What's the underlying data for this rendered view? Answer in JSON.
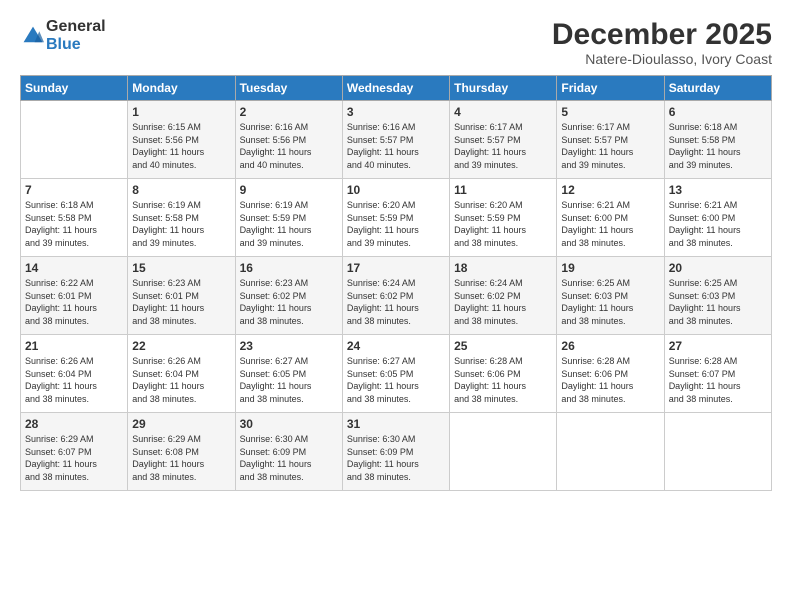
{
  "logo": {
    "general": "General",
    "blue": "Blue"
  },
  "title": "December 2025",
  "location": "Natere-Dioulasso, Ivory Coast",
  "days_of_week": [
    "Sunday",
    "Monday",
    "Tuesday",
    "Wednesday",
    "Thursday",
    "Friday",
    "Saturday"
  ],
  "weeks": [
    [
      {
        "day": "",
        "info": ""
      },
      {
        "day": "1",
        "info": "Sunrise: 6:15 AM\nSunset: 5:56 PM\nDaylight: 11 hours\nand 40 minutes."
      },
      {
        "day": "2",
        "info": "Sunrise: 6:16 AM\nSunset: 5:56 PM\nDaylight: 11 hours\nand 40 minutes."
      },
      {
        "day": "3",
        "info": "Sunrise: 6:16 AM\nSunset: 5:57 PM\nDaylight: 11 hours\nand 40 minutes."
      },
      {
        "day": "4",
        "info": "Sunrise: 6:17 AM\nSunset: 5:57 PM\nDaylight: 11 hours\nand 39 minutes."
      },
      {
        "day": "5",
        "info": "Sunrise: 6:17 AM\nSunset: 5:57 PM\nDaylight: 11 hours\nand 39 minutes."
      },
      {
        "day": "6",
        "info": "Sunrise: 6:18 AM\nSunset: 5:58 PM\nDaylight: 11 hours\nand 39 minutes."
      }
    ],
    [
      {
        "day": "7",
        "info": "Sunrise: 6:18 AM\nSunset: 5:58 PM\nDaylight: 11 hours\nand 39 minutes."
      },
      {
        "day": "8",
        "info": "Sunrise: 6:19 AM\nSunset: 5:58 PM\nDaylight: 11 hours\nand 39 minutes."
      },
      {
        "day": "9",
        "info": "Sunrise: 6:19 AM\nSunset: 5:59 PM\nDaylight: 11 hours\nand 39 minutes."
      },
      {
        "day": "10",
        "info": "Sunrise: 6:20 AM\nSunset: 5:59 PM\nDaylight: 11 hours\nand 39 minutes."
      },
      {
        "day": "11",
        "info": "Sunrise: 6:20 AM\nSunset: 5:59 PM\nDaylight: 11 hours\nand 38 minutes."
      },
      {
        "day": "12",
        "info": "Sunrise: 6:21 AM\nSunset: 6:00 PM\nDaylight: 11 hours\nand 38 minutes."
      },
      {
        "day": "13",
        "info": "Sunrise: 6:21 AM\nSunset: 6:00 PM\nDaylight: 11 hours\nand 38 minutes."
      }
    ],
    [
      {
        "day": "14",
        "info": "Sunrise: 6:22 AM\nSunset: 6:01 PM\nDaylight: 11 hours\nand 38 minutes."
      },
      {
        "day": "15",
        "info": "Sunrise: 6:23 AM\nSunset: 6:01 PM\nDaylight: 11 hours\nand 38 minutes."
      },
      {
        "day": "16",
        "info": "Sunrise: 6:23 AM\nSunset: 6:02 PM\nDaylight: 11 hours\nand 38 minutes."
      },
      {
        "day": "17",
        "info": "Sunrise: 6:24 AM\nSunset: 6:02 PM\nDaylight: 11 hours\nand 38 minutes."
      },
      {
        "day": "18",
        "info": "Sunrise: 6:24 AM\nSunset: 6:02 PM\nDaylight: 11 hours\nand 38 minutes."
      },
      {
        "day": "19",
        "info": "Sunrise: 6:25 AM\nSunset: 6:03 PM\nDaylight: 11 hours\nand 38 minutes."
      },
      {
        "day": "20",
        "info": "Sunrise: 6:25 AM\nSunset: 6:03 PM\nDaylight: 11 hours\nand 38 minutes."
      }
    ],
    [
      {
        "day": "21",
        "info": "Sunrise: 6:26 AM\nSunset: 6:04 PM\nDaylight: 11 hours\nand 38 minutes."
      },
      {
        "day": "22",
        "info": "Sunrise: 6:26 AM\nSunset: 6:04 PM\nDaylight: 11 hours\nand 38 minutes."
      },
      {
        "day": "23",
        "info": "Sunrise: 6:27 AM\nSunset: 6:05 PM\nDaylight: 11 hours\nand 38 minutes."
      },
      {
        "day": "24",
        "info": "Sunrise: 6:27 AM\nSunset: 6:05 PM\nDaylight: 11 hours\nand 38 minutes."
      },
      {
        "day": "25",
        "info": "Sunrise: 6:28 AM\nSunset: 6:06 PM\nDaylight: 11 hours\nand 38 minutes."
      },
      {
        "day": "26",
        "info": "Sunrise: 6:28 AM\nSunset: 6:06 PM\nDaylight: 11 hours\nand 38 minutes."
      },
      {
        "day": "27",
        "info": "Sunrise: 6:28 AM\nSunset: 6:07 PM\nDaylight: 11 hours\nand 38 minutes."
      }
    ],
    [
      {
        "day": "28",
        "info": "Sunrise: 6:29 AM\nSunset: 6:07 PM\nDaylight: 11 hours\nand 38 minutes."
      },
      {
        "day": "29",
        "info": "Sunrise: 6:29 AM\nSunset: 6:08 PM\nDaylight: 11 hours\nand 38 minutes."
      },
      {
        "day": "30",
        "info": "Sunrise: 6:30 AM\nSunset: 6:09 PM\nDaylight: 11 hours\nand 38 minutes."
      },
      {
        "day": "31",
        "info": "Sunrise: 6:30 AM\nSunset: 6:09 PM\nDaylight: 11 hours\nand 38 minutes."
      },
      {
        "day": "",
        "info": ""
      },
      {
        "day": "",
        "info": ""
      },
      {
        "day": "",
        "info": ""
      }
    ]
  ]
}
